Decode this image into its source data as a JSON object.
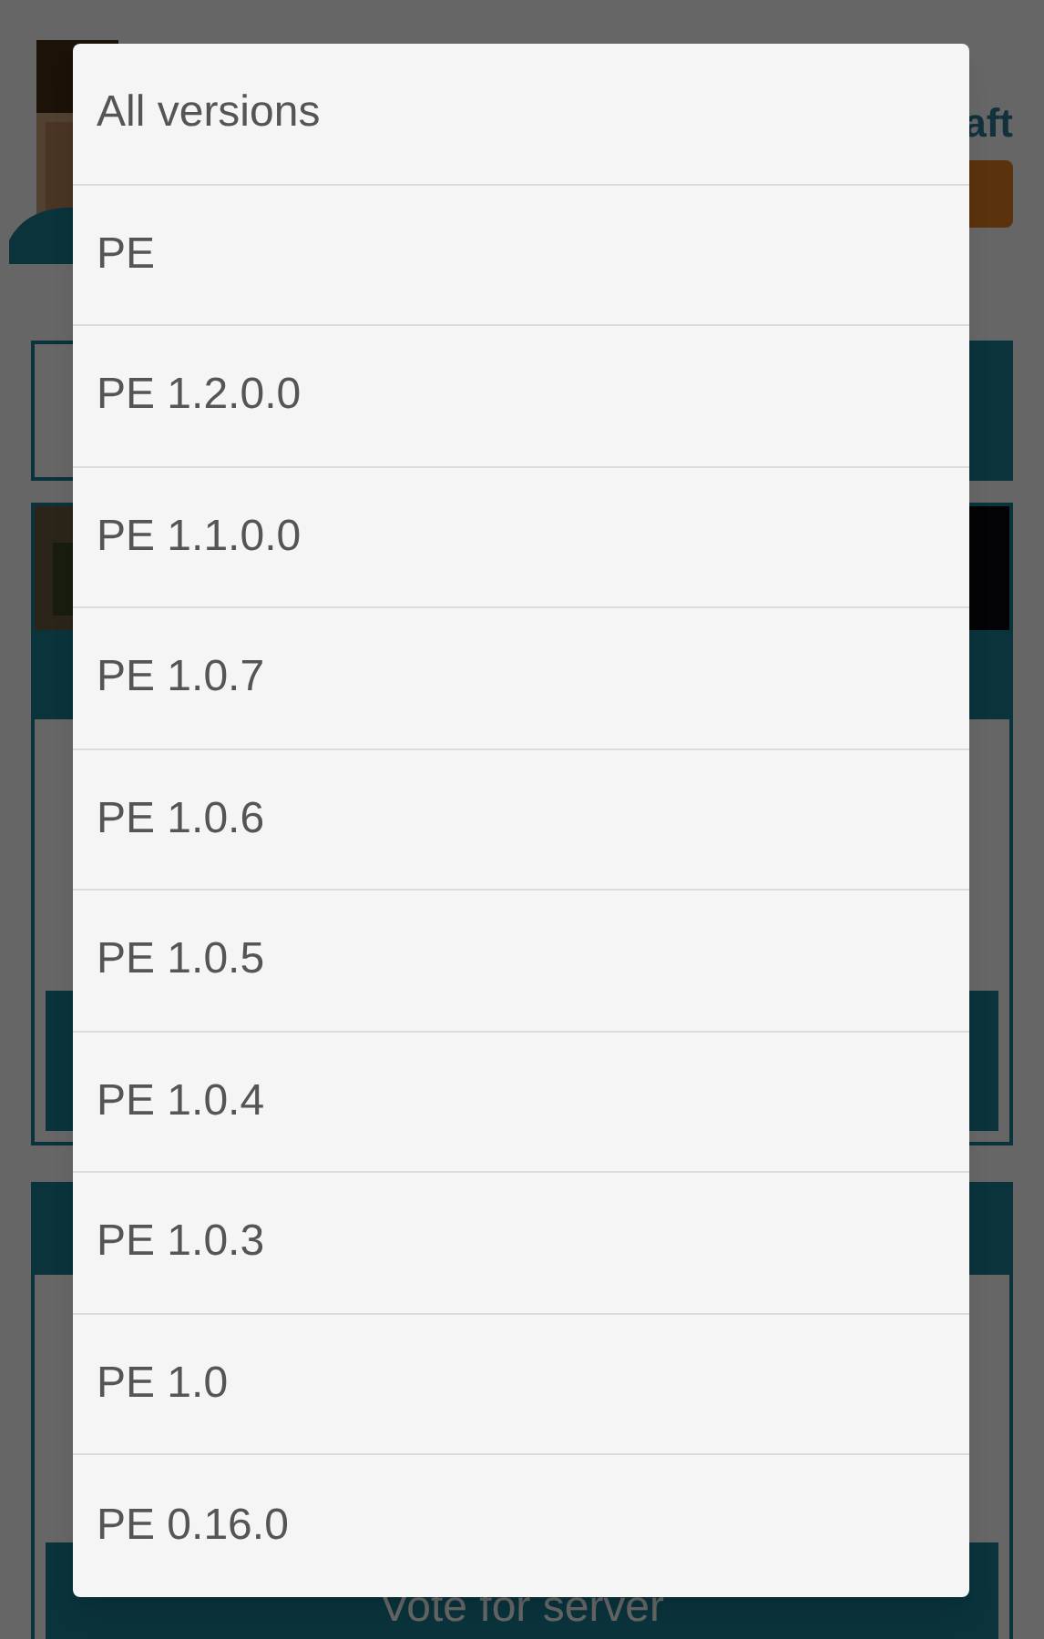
{
  "page": {
    "header_text": "aft",
    "vote_button": "Vote for server"
  },
  "dropdown": {
    "items": [
      {
        "label": "All versions"
      },
      {
        "label": "PE"
      },
      {
        "label": "PE 1.2.0.0"
      },
      {
        "label": "PE 1.1.0.0"
      },
      {
        "label": "PE 1.0.7"
      },
      {
        "label": "PE 1.0.6"
      },
      {
        "label": "PE 1.0.5"
      },
      {
        "label": "PE 1.0.4"
      },
      {
        "label": "PE 1.0.3"
      },
      {
        "label": "PE 1.0"
      },
      {
        "label": "PE 0.16.0"
      }
    ]
  }
}
